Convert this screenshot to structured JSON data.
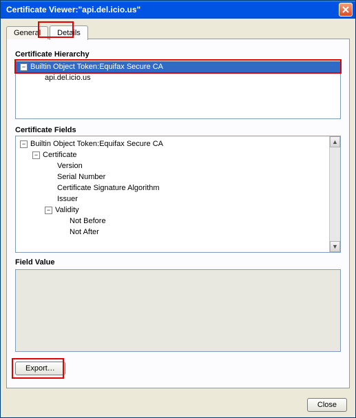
{
  "window": {
    "title": "Certificate Viewer:\"api.del.icio.us\""
  },
  "tabs": {
    "general": "General",
    "details": "Details"
  },
  "labels": {
    "hierarchy": "Certificate Hierarchy",
    "fields": "Certificate Fields",
    "field_value": "Field Value"
  },
  "hierarchy": {
    "root": "Builtin Object Token:Equifax Secure CA",
    "child": "api.del.icio.us"
  },
  "fields": {
    "root": "Builtin Object Token:Equifax Secure CA",
    "certificate": "Certificate",
    "version": "Version",
    "serial": "Serial Number",
    "sigalg": "Certificate Signature Algorithm",
    "issuer": "Issuer",
    "validity": "Validity",
    "not_before": "Not Before",
    "not_after": "Not After"
  },
  "buttons": {
    "export": "Export…",
    "close": "Close"
  }
}
